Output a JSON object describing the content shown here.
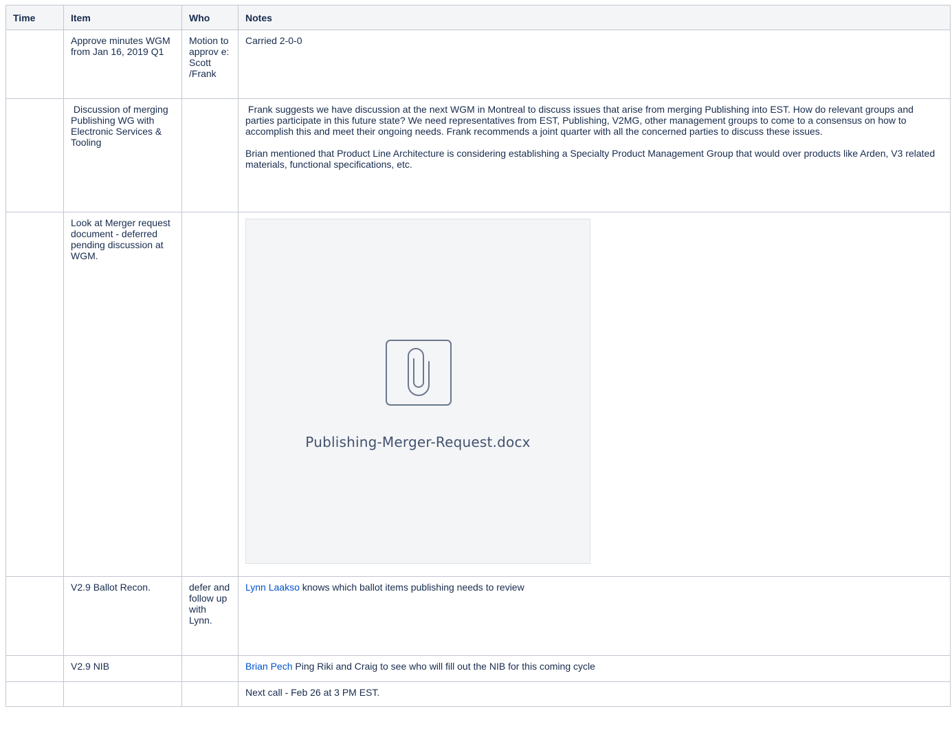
{
  "table": {
    "headers": {
      "time": "Time",
      "item": "Item",
      "who": "Who",
      "notes": "Notes"
    },
    "rows": [
      {
        "time": "",
        "item": "Approve minutes WGM from Jan 16, 2019 Q1",
        "who": "Motion to approv e: Scott /Frank",
        "notes": [
          "Carried 2-0-0"
        ]
      },
      {
        "time": "",
        "item": " Discussion of merging Publishing WG with Electronic Services & Tooling",
        "who": "",
        "notes": [
          " Frank suggests we have discussion at the next WGM in Montreal to discuss issues that arise from merging Publishing into EST. How do relevant groups and parties participate in this future state? We need representatives from EST, Publishing, V2MG, other management groups to come to a consensus on how to accomplish this and meet their ongoing needs. Frank recommends a joint quarter with all the concerned parties to discuss these issues.",
          "Brian mentioned that Product Line Architecture is considering establishing a Specialty Product Management Group that would over products like Arden, V3 related materials, functional specifications, etc."
        ]
      },
      {
        "time": "",
        "item": "Look at Merger request document - deferred pending discussion at WGM.",
        "who": "",
        "attachment": {
          "file_name": "Publishing-Merger-Request.docx",
          "icon": "paperclip-icon"
        }
      },
      {
        "time": "",
        "item": "V2.9 Ballot Recon.",
        "who": "defer and follow up with Lynn.",
        "mention": "Lynn Laakso",
        "notes_text": " knows which ballot items publishing needs to review"
      },
      {
        "time": "",
        "item": "V2.9 NIB",
        "who": "",
        "mention": "Brian Pech",
        "notes_text": " Ping Riki and Craig to see who will fill out the NIB for this coming cycle"
      },
      {
        "time": "",
        "item": "",
        "who": "",
        "notes_text": "Next call - Feb 26 at 3 PM EST."
      }
    ]
  },
  "colors": {
    "border": "#c1c7d0",
    "header_bg": "#f4f5f7",
    "link": "#0052cc",
    "text": "#172b4d"
  }
}
